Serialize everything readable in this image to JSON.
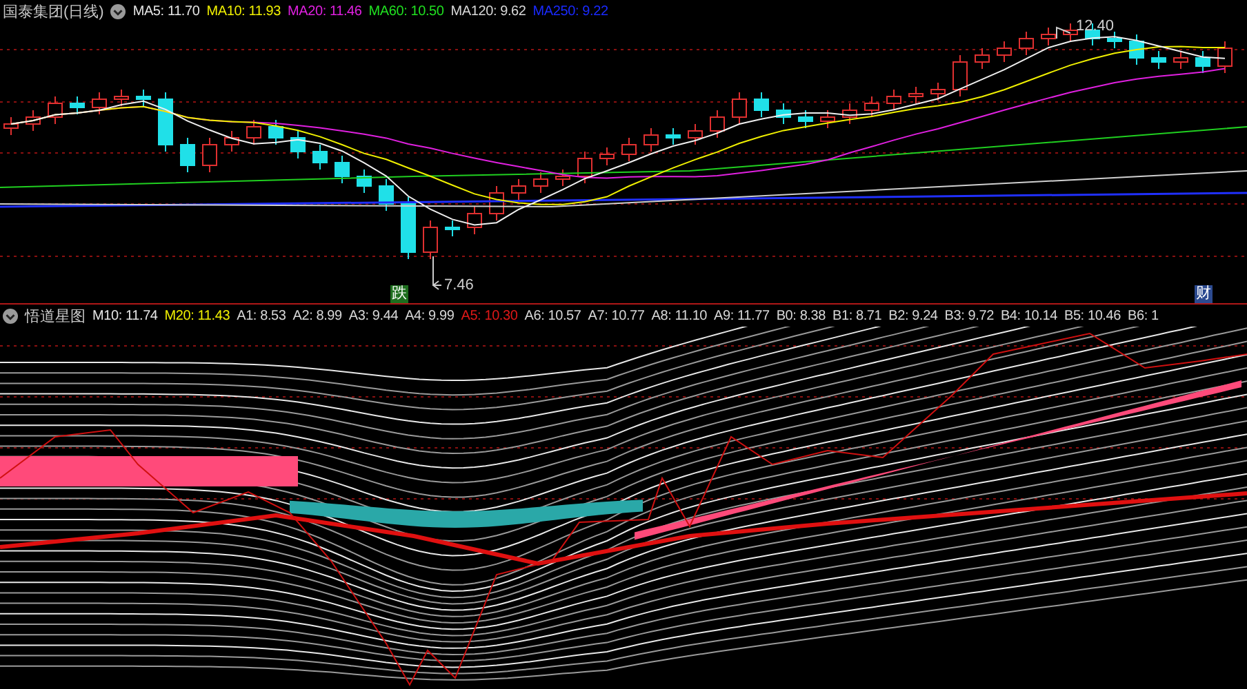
{
  "top_panel": {
    "title": "国泰集团(日线)",
    "indicators": [
      {
        "text": "MA5: 11.70",
        "color": "#e6e6e6"
      },
      {
        "text": "MA10: 11.93",
        "color": "#f0f000"
      },
      {
        "text": "MA20: 11.46",
        "color": "#e020e0"
      },
      {
        "text": "MA60: 10.50",
        "color": "#20e020"
      },
      {
        "text": "MA120: 9.62",
        "color": "#d8d8d8"
      },
      {
        "text": "MA250: 9.22",
        "color": "#1a2aff"
      }
    ],
    "high_label": "12.40",
    "low_label": "7.46",
    "event_markers": [
      {
        "text": "跌",
        "color": "#1e6e1e"
      },
      {
        "text": "财",
        "color": "#2c4a90"
      }
    ]
  },
  "bottom_panel": {
    "title": "悟道星图",
    "indicators": [
      {
        "text": "M10: 11.74",
        "color": "#e6e6e6"
      },
      {
        "text": "M20: 11.43",
        "color": "#f0f000"
      },
      {
        "text": "A1: 8.53",
        "color": "#d8d8d8"
      },
      {
        "text": "A2: 8.99",
        "color": "#d8d8d8"
      },
      {
        "text": "A3: 9.44",
        "color": "#d8d8d8"
      },
      {
        "text": "A4: 9.99",
        "color": "#d8d8d8"
      },
      {
        "text": "A5: 10.30",
        "color": "#e01818"
      },
      {
        "text": "A6: 10.57",
        "color": "#d8d8d8"
      },
      {
        "text": "A7: 10.77",
        "color": "#d8d8d8"
      },
      {
        "text": "A8: 11.10",
        "color": "#d8d8d8"
      },
      {
        "text": "A9: 11.77",
        "color": "#d8d8d8"
      },
      {
        "text": "B0: 8.38",
        "color": "#d8d8d8"
      },
      {
        "text": "B1: 8.71",
        "color": "#d8d8d8"
      },
      {
        "text": "B2: 9.24",
        "color": "#d8d8d8"
      },
      {
        "text": "B3: 9.72",
        "color": "#d8d8d8"
      },
      {
        "text": "B4: 10.14",
        "color": "#d8d8d8"
      },
      {
        "text": "B5: 10.46",
        "color": "#d8d8d8"
      },
      {
        "text": "B6: 1",
        "color": "#d8d8d8"
      }
    ]
  }
}
